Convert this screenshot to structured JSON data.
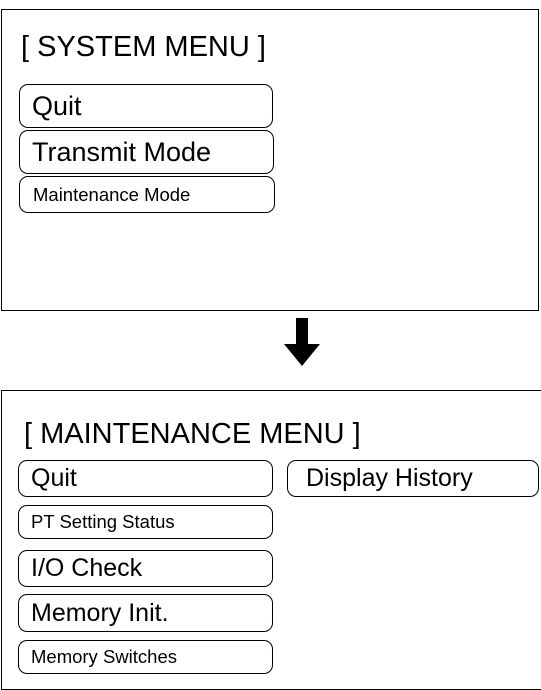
{
  "system_menu": {
    "title": "[ SYSTEM MENU ]",
    "buttons": {
      "quit": "Quit",
      "transmit_mode": "Transmit Mode",
      "maintenance_mode": "Maintenance Mode"
    }
  },
  "arrow": {
    "icon": "arrow-down-icon",
    "color": "#000000"
  },
  "maintenance_menu": {
    "title": "[ MAINTENANCE MENU ]",
    "buttons": {
      "quit": "Quit",
      "display_history": "Display History",
      "pt_setting_status": "PT Setting Status",
      "io_check": "I/O Check",
      "memory_init": "Memory Init.",
      "memory_switches": "Memory Switches"
    }
  }
}
